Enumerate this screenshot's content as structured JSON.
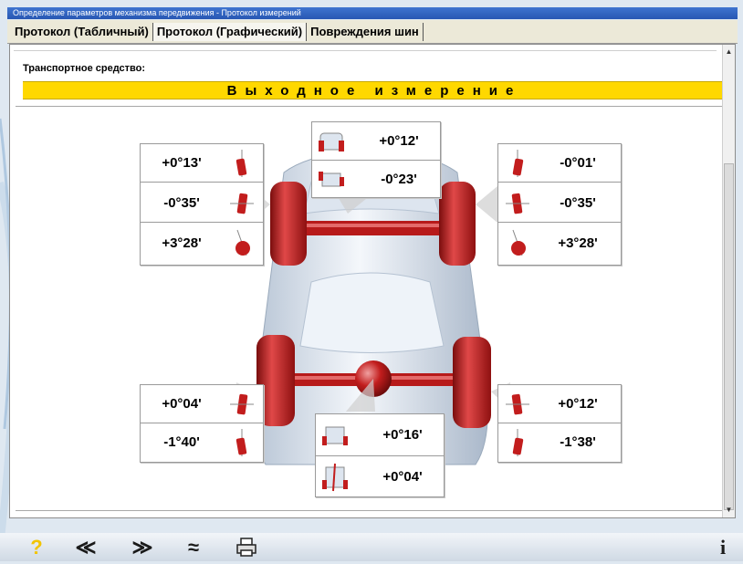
{
  "window": {
    "title": "Определение параметров механизма передвижения - Протокол измерений"
  },
  "tabs": [
    {
      "label": "Протокол (Табличный)"
    },
    {
      "label": "Протокол (Графический)"
    },
    {
      "label": "Повреждения шин"
    }
  ],
  "report": {
    "vehicle_label": "Транспортное средство:",
    "banner": "Выходное измерение",
    "front_left": {
      "camber": "+0°13'",
      "toe": "-0°35'",
      "caster": "+3°28'"
    },
    "front_axle": {
      "total_toe": "+0°12'",
      "setback": "-0°23'"
    },
    "front_right": {
      "camber": "-0°01'",
      "toe": "-0°35'",
      "caster": "+3°28'"
    },
    "rear_left": {
      "toe": "+0°04'",
      "camber": "-1°40'"
    },
    "rear_axle": {
      "total_toe": "+0°16'",
      "thrust": "+0°04'"
    },
    "rear_right": {
      "toe": "+0°12'",
      "camber": "-1°38'"
    }
  },
  "toolbar": {
    "help": "?",
    "back": "≪",
    "forward": "≫",
    "up": "≈",
    "print": "print-icon",
    "info": "i"
  },
  "colors": {
    "banner": "#ffd800",
    "wheel": "#c21d1d",
    "title_bar": "#2f62be"
  }
}
